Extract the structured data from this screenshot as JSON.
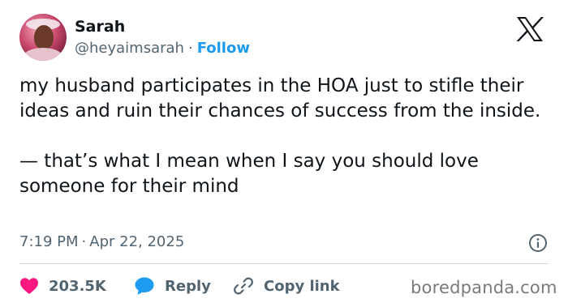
{
  "author": {
    "name": "Sarah",
    "handle": "@heyaimsarah",
    "separator": "·",
    "follow_label": "Follow"
  },
  "tweet": {
    "line1": "my husband participates in the HOA just to stifle their ideas and ruin their chances of success from the inside.",
    "line2": "— that’s what I mean when I say you should love someone for their mind"
  },
  "meta": {
    "time": "7:19 PM",
    "separator": "·",
    "date": "Apr 22, 2025"
  },
  "actions": {
    "likes": "203.5K",
    "reply_label": "Reply",
    "copy_label": "Copy link"
  },
  "watermark": "boredpanda.com",
  "colors": {
    "text": "#0f1419",
    "secondary": "#536471",
    "link": "#1d9bf0",
    "like": "#f91880",
    "reply": "#1d9bf0",
    "divider": "#cfd9de"
  },
  "icons": [
    "x-logo-icon",
    "info-icon",
    "heart-icon",
    "reply-bubble-icon",
    "link-icon"
  ]
}
